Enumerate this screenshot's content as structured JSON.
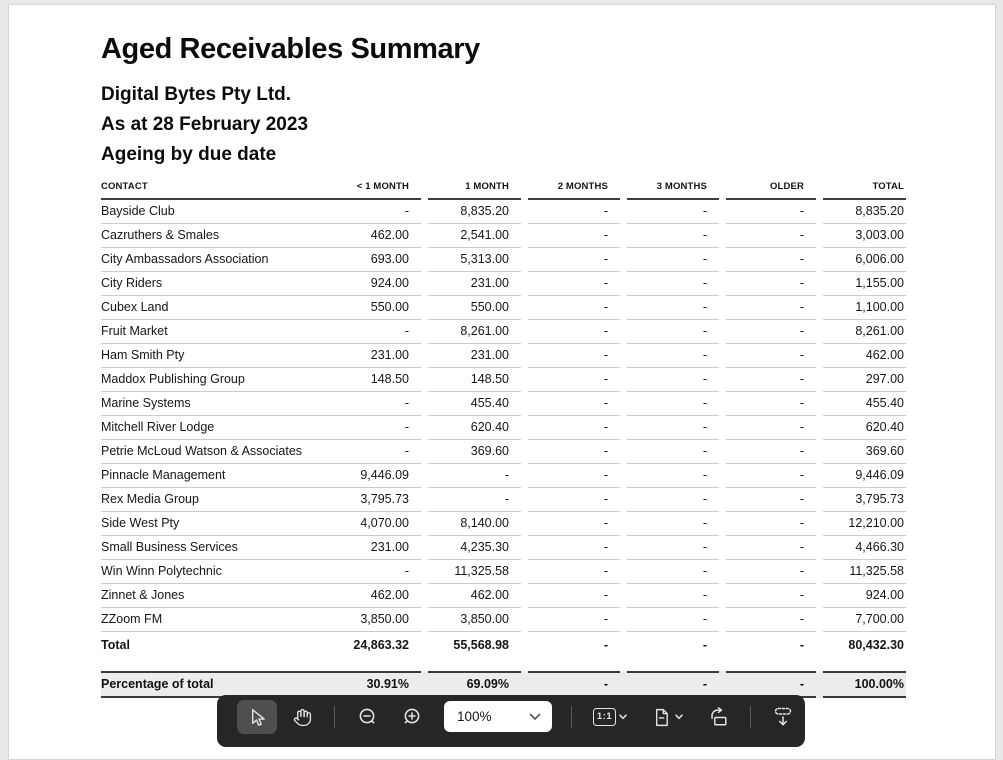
{
  "report": {
    "title": "Aged Receivables Summary",
    "company": "Digital Bytes Pty Ltd.",
    "as_at": "As at 28 February 2023",
    "basis": "Ageing by due date"
  },
  "table": {
    "columns": [
      "CONTACT",
      "< 1 MONTH",
      "1 MONTH",
      "2 MONTHS",
      "3 MONTHS",
      "OLDER",
      "TOTAL"
    ],
    "rows": [
      {
        "contact": "Bayside Club",
        "values": [
          "-",
          "8,835.20",
          "-",
          "-",
          "-",
          "8,835.20"
        ]
      },
      {
        "contact": "Cazruthers & Smales",
        "values": [
          "462.00",
          "2,541.00",
          "-",
          "-",
          "-",
          "3,003.00"
        ]
      },
      {
        "contact": "City Ambassadors Association",
        "values": [
          "693.00",
          "5,313.00",
          "-",
          "-",
          "-",
          "6,006.00"
        ]
      },
      {
        "contact": "City Riders",
        "values": [
          "924.00",
          "231.00",
          "-",
          "-",
          "-",
          "1,155.00"
        ]
      },
      {
        "contact": "Cubex Land",
        "values": [
          "550.00",
          "550.00",
          "-",
          "-",
          "-",
          "1,100.00"
        ]
      },
      {
        "contact": "Fruit Market",
        "values": [
          "-",
          "8,261.00",
          "-",
          "-",
          "-",
          "8,261.00"
        ]
      },
      {
        "contact": "Ham Smith Pty",
        "values": [
          "231.00",
          "231.00",
          "-",
          "-",
          "-",
          "462.00"
        ]
      },
      {
        "contact": "Maddox Publishing Group",
        "values": [
          "148.50",
          "148.50",
          "-",
          "-",
          "-",
          "297.00"
        ]
      },
      {
        "contact": "Marine Systems",
        "values": [
          "-",
          "455.40",
          "-",
          "-",
          "-",
          "455.40"
        ]
      },
      {
        "contact": "Mitchell River Lodge",
        "values": [
          "-",
          "620.40",
          "-",
          "-",
          "-",
          "620.40"
        ]
      },
      {
        "contact": "Petrie McLoud Watson & Associates",
        "values": [
          "-",
          "369.60",
          "-",
          "-",
          "-",
          "369.60"
        ]
      },
      {
        "contact": "Pinnacle Management",
        "values": [
          "9,446.09",
          "-",
          "-",
          "-",
          "-",
          "9,446.09"
        ]
      },
      {
        "contact": "Rex Media Group",
        "values": [
          "3,795.73",
          "-",
          "-",
          "-",
          "-",
          "3,795.73"
        ]
      },
      {
        "contact": "Side West Pty",
        "values": [
          "4,070.00",
          "8,140.00",
          "-",
          "-",
          "-",
          "12,210.00"
        ]
      },
      {
        "contact": "Small Business Services",
        "values": [
          "231.00",
          "4,235.30",
          "-",
          "-",
          "-",
          "4,466.30"
        ]
      },
      {
        "contact": "Win Winn Polytechnic",
        "values": [
          "-",
          "11,325.58",
          "-",
          "-",
          "-",
          "11,325.58"
        ]
      },
      {
        "contact": "Zinnet & Jones",
        "values": [
          "462.00",
          "462.00",
          "-",
          "-",
          "-",
          "924.00"
        ]
      },
      {
        "contact": "ZZoom FM",
        "values": [
          "3,850.00",
          "3,850.00",
          "-",
          "-",
          "-",
          "7,700.00"
        ]
      }
    ],
    "total_row": {
      "label": "Total",
      "values": [
        "24,863.32",
        "55,568.98",
        "-",
        "-",
        "-",
        "80,432.30"
      ]
    },
    "percentage_row": {
      "label": "Percentage of total",
      "values": [
        "30.91%",
        "69.09%",
        "-",
        "-",
        "-",
        "100.00%"
      ]
    }
  },
  "toolbar": {
    "zoom_level": "100%",
    "actual_size_label": "1:1",
    "colors": {
      "background": "#262626",
      "selected_tool_bg": "#4f4f4f",
      "icon": "#e3e3e3",
      "dropdown_bg": "#ffffff"
    }
  }
}
